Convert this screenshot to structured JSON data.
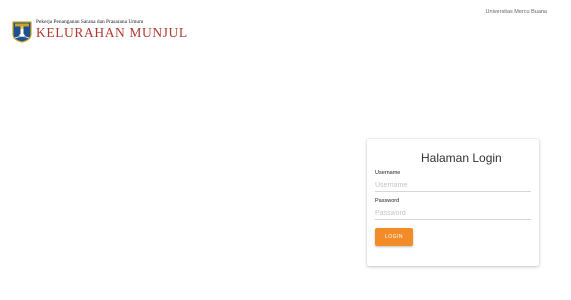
{
  "header": {
    "subtitle": "Pekerja Penanganan Sarana dan Prasarana Umum",
    "title": "KELURAHAN MUNJUL",
    "university": "Universitas Mercu Buana",
    "logo_icon": "jakarta-crest-icon"
  },
  "login": {
    "title": "Halaman Login",
    "username_label": "Username",
    "username_placeholder": "Username",
    "username_value": "",
    "password_label": "Password",
    "password_placeholder": "Password",
    "password_value": "",
    "button_label": "LOGIN"
  },
  "colors": {
    "brand_title": "#b03a2e",
    "button": "#f28c28"
  }
}
